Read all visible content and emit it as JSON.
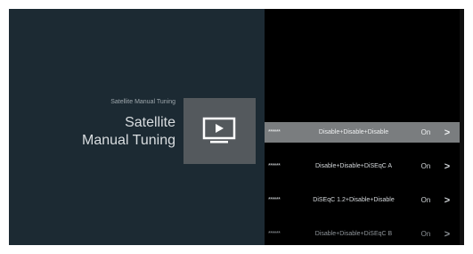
{
  "page": {
    "breadcrumb": "Satellite Manual Tuning",
    "title_line1": "Satellite",
    "title_line2": "Manual Tuning"
  },
  "tile": {
    "icon": "tv-play-icon"
  },
  "list": {
    "items": [
      {
        "password": "******",
        "mode": "Disable+Disable+Disable",
        "status": "On",
        "arrow": ">"
      },
      {
        "password": "******",
        "mode": "Disable+Disable+DiSEqC A",
        "status": "On",
        "arrow": ">"
      },
      {
        "password": "******",
        "mode": "DiSEqC 1.2+Disable+Disable",
        "status": "On",
        "arrow": ">"
      },
      {
        "password": "******",
        "mode": "Disable+Disable+DiSEqC B",
        "status": "On",
        "arrow": ">"
      }
    ]
  },
  "colors": {
    "panel_bg": "#1c2a33",
    "screen_bg": "#000000",
    "tile_bg": "#54595d",
    "selected_row_bg": "#7a7d7f"
  }
}
